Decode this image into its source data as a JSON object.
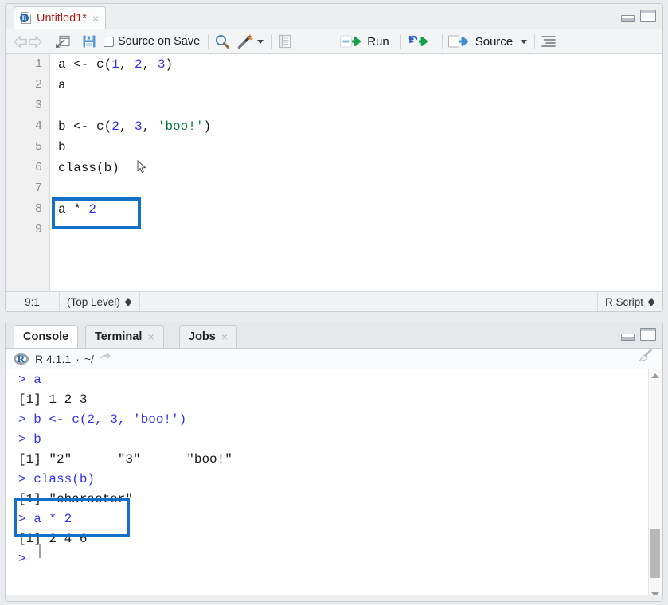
{
  "source_pane": {
    "tab": {
      "title": "Untitled1*",
      "close_label": "×",
      "icon": "r-document-icon"
    },
    "window_controls": {
      "minimize": "minimize-icon",
      "maximize": "maximize-icon"
    },
    "toolbar": {
      "back": "back-arrow-icon",
      "forward": "forward-arrow-icon",
      "popout": "show-in-new-window-icon",
      "save": "save-icon",
      "source_on_save_label": "Source on Save",
      "find": "find-icon",
      "code_tools": "magic-wand-icon",
      "code_tools_caret": "chevron-down-icon",
      "compile_report": "compile-report-icon",
      "run_label": "Run",
      "run_icon": "run-icon",
      "rerun_icon": "re-run-icon",
      "source_label": "Source",
      "source_icon": "source-icon",
      "source_caret": "chevron-down-icon",
      "outline": "outline-icon"
    },
    "gutter": [
      "1",
      "2",
      "3",
      "4",
      "5",
      "6",
      "7",
      "8",
      "9"
    ],
    "code": [
      {
        "line": 1,
        "tokens": [
          {
            "t": "a <- c(",
            "c": "plain"
          },
          {
            "t": "1",
            "c": "num"
          },
          {
            "t": ", ",
            "c": "plain"
          },
          {
            "t": "2",
            "c": "num"
          },
          {
            "t": ", ",
            "c": "plain"
          },
          {
            "t": "3",
            "c": "num"
          },
          {
            "t": ")",
            "c": "plain"
          }
        ]
      },
      {
        "line": 2,
        "tokens": [
          {
            "t": "a",
            "c": "plain"
          }
        ]
      },
      {
        "line": 3,
        "tokens": []
      },
      {
        "line": 4,
        "tokens": [
          {
            "t": "b <- c(",
            "c": "plain"
          },
          {
            "t": "2",
            "c": "num"
          },
          {
            "t": ", ",
            "c": "plain"
          },
          {
            "t": "3",
            "c": "num"
          },
          {
            "t": ", ",
            "c": "plain"
          },
          {
            "t": "'boo!'",
            "c": "str"
          },
          {
            "t": ")",
            "c": "plain"
          }
        ]
      },
      {
        "line": 5,
        "tokens": [
          {
            "t": "b",
            "c": "plain"
          }
        ]
      },
      {
        "line": 6,
        "tokens": [
          {
            "t": "class(b)",
            "c": "plain"
          }
        ]
      },
      {
        "line": 7,
        "tokens": []
      },
      {
        "line": 8,
        "tokens": [
          {
            "t": "a * ",
            "c": "plain"
          },
          {
            "t": "2",
            "c": "num"
          }
        ]
      },
      {
        "line": 9,
        "tokens": []
      }
    ],
    "highlight_line": 8,
    "status": {
      "cursor_position": "9:1",
      "scope": "(Top Level)",
      "file_type": "R Script"
    }
  },
  "console_pane": {
    "tabs": [
      {
        "label": "Console",
        "active": true,
        "closable": false
      },
      {
        "label": "Terminal",
        "active": false,
        "closable": true,
        "close_label": "×"
      },
      {
        "label": "Jobs",
        "active": false,
        "closable": true,
        "close_label": "×"
      }
    ],
    "window_controls": {
      "minimize": "minimize-icon",
      "maximize": "maximize-icon"
    },
    "info": {
      "r_version": "R 4.1.1",
      "separator": "·",
      "working_directory": "~/",
      "share_icon": "open-in-window-icon",
      "broom_icon": "clear-console-icon"
    },
    "output": [
      {
        "text": "> a",
        "kind": "input"
      },
      {
        "text": "[1] 1 2 3",
        "kind": "output"
      },
      {
        "text": "> b <- c(2, 3, 'boo!')",
        "kind": "input"
      },
      {
        "text": "> b",
        "kind": "input"
      },
      {
        "text": "[1] \"2\"      \"3\"      \"boo!\"",
        "kind": "output"
      },
      {
        "text": "> class(b)",
        "kind": "input"
      },
      {
        "text": "[1] \"character\"",
        "kind": "output"
      },
      {
        "text": "> a * 2",
        "kind": "input"
      },
      {
        "text": "[1] 2 4 6",
        "kind": "output"
      },
      {
        "text": ">",
        "kind": "input"
      }
    ],
    "highlight_lines": [
      7,
      8
    ],
    "scrollbar": {
      "up_arrow": "scroll-up-icon",
      "down_arrow": "scroll-down-icon"
    }
  },
  "colors": {
    "highlight_box": "#1270c8",
    "console_input": "#3333ee",
    "console_output": "#1a1a1a",
    "code_number": "#3333ee",
    "code_string": "#007f3d",
    "tab_title": "#a8201a"
  }
}
